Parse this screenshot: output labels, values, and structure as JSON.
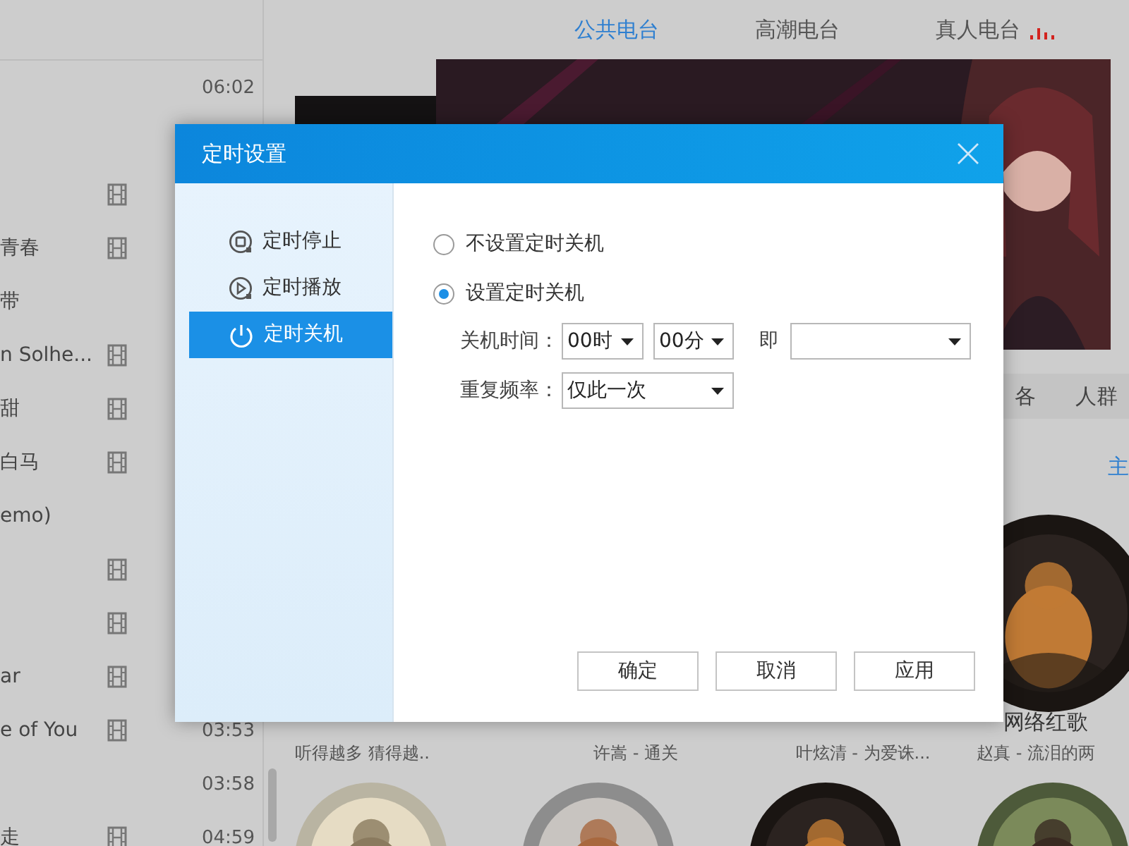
{
  "playlist": {
    "rows": [
      {
        "title": null,
        "has_mv": false,
        "time": "06:02"
      },
      {
        "title": null,
        "has_mv": false,
        "time": null
      },
      {
        "title": null,
        "has_mv": true,
        "time": null
      },
      {
        "title": "青春",
        "has_mv": true,
        "time": null
      },
      {
        "title": "带",
        "has_mv": false,
        "time": null
      },
      {
        "title": "n Solhe...",
        "has_mv": true,
        "time": null
      },
      {
        "title": "甜",
        "has_mv": true,
        "time": null
      },
      {
        "title": "白马",
        "has_mv": true,
        "time": null
      },
      {
        "title": "emo)",
        "has_mv": false,
        "time": null
      },
      {
        "title": null,
        "has_mv": true,
        "time": null
      },
      {
        "title": null,
        "has_mv": true,
        "time": null
      },
      {
        "title": "ar",
        "has_mv": true,
        "time": null
      },
      {
        "title": "e of You",
        "has_mv": true,
        "time": "03:53"
      },
      {
        "title": null,
        "has_mv": false,
        "time": "03:58"
      },
      {
        "title": "走",
        "has_mv": true,
        "time": "04:59"
      }
    ]
  },
  "radio_tabs": [
    {
      "label": "公共电台",
      "selected": true,
      "playing": false
    },
    {
      "label": "高潮电台",
      "selected": false,
      "playing": false
    },
    {
      "label": "真人电台",
      "selected": false,
      "playing": true
    }
  ],
  "category_tabs": [
    "各",
    "人群"
  ],
  "section_link": "主",
  "featured": {
    "title": "网络红歌"
  },
  "captions": [
    "听得越多 猜得越..",
    "许嵩 - 通关",
    "叶炫清 - 为爱诛...",
    "赵真 - 流泪的两"
  ],
  "dialog": {
    "title": "定时设置",
    "nav": [
      {
        "label": "定时停止",
        "kind": "stop",
        "selected": false
      },
      {
        "label": "定时播放",
        "kind": "play",
        "selected": false
      },
      {
        "label": "定时关机",
        "kind": "power",
        "selected": true
      }
    ],
    "options": [
      {
        "label": "不设置定时关机",
        "selected": false
      },
      {
        "label": "设置定时关机",
        "selected": true
      }
    ],
    "time_row": {
      "label": "关机时间：",
      "hour": "00时",
      "minute": "00分",
      "then_label": "即"
    },
    "repeat_row": {
      "label": "重复频率：",
      "value": "仅此一次"
    },
    "buttons": [
      "确定",
      "取消",
      "应用"
    ]
  }
}
